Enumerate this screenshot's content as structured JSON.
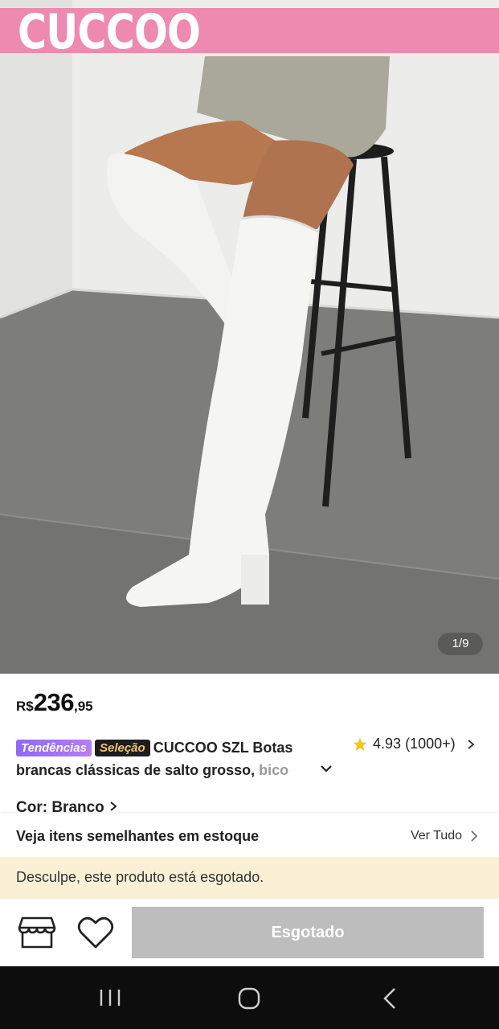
{
  "brand": {
    "name": "CUCCOO",
    "bar_color": "#ee89b0"
  },
  "gallery": {
    "counter": "1/9"
  },
  "price": {
    "currency": "R$",
    "integer": "236",
    "decimal": ",95"
  },
  "product": {
    "badges": {
      "trend": "Tendências",
      "selection": "Seleção"
    },
    "title_main": "CUCCOO SZL Botas brancas clássicas de salto grosso, ",
    "title_fade": "bico",
    "rating": "4.93",
    "rating_count": "(1000+)",
    "color_label": "Cor: Branco"
  },
  "similar": {
    "label": "Veja itens semelhantes em estoque",
    "see_all": "Ver Tudo"
  },
  "notice": {
    "sold_out_message": "Desculpe, este produto está esgotado."
  },
  "actions": {
    "sold_out_button": "Esgotado",
    "button_color": "#bdbdbd"
  },
  "icons": {
    "store": "store-icon",
    "favorite": "heart-icon",
    "star": "star-icon",
    "recents": "recents-icon",
    "home": "home-icon",
    "back": "back-icon"
  }
}
